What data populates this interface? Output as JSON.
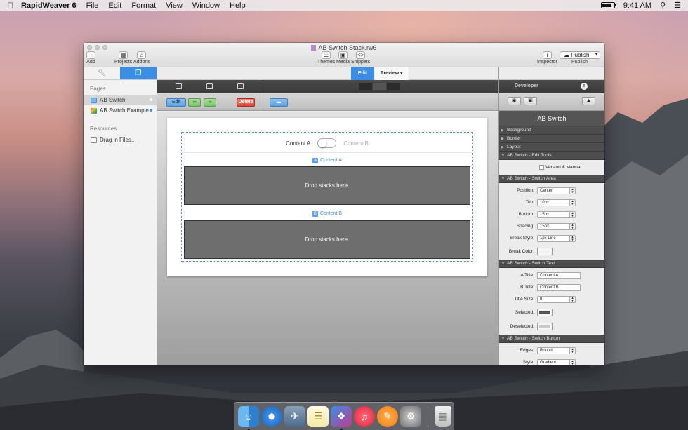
{
  "menubar": {
    "app_name": "RapidWeaver 6",
    "menus": [
      "File",
      "Edit",
      "Format",
      "View",
      "Window",
      "Help"
    ],
    "time": "9:41 AM",
    "battery_level": 0.85
  },
  "window": {
    "title": "AB Switch Stack.rw6",
    "toolbar": {
      "add": "Add",
      "projects": "Projects",
      "addons": "Addons",
      "themes": "Themes",
      "media": "Media",
      "snippets": "Snippets",
      "inspector": "Inspector",
      "publish_button": "Publish",
      "publish_label": "Publish"
    }
  },
  "sidebar": {
    "pages_heading": "Pages",
    "pages": [
      {
        "label": "AB Switch",
        "selected": true
      },
      {
        "label": "AB Switch Example",
        "selected": false
      }
    ],
    "resources_heading": "Resources",
    "resources_item": "Drag in Files..."
  },
  "main": {
    "edit_tab": "Edit",
    "preview_tab": "Preview",
    "stack_toolbar": {
      "edit": "Edit",
      "delete": "Delete"
    },
    "switch": {
      "title_a": "Content A",
      "title_b": "Content B"
    },
    "content_a_label": "Content A",
    "content_b_label": "Content B",
    "drop_a": "Drop stacks here.",
    "drop_b": "Drop stacks here."
  },
  "inspector": {
    "developer_label": "Developer",
    "title": "AB Switch",
    "sections": {
      "background": "Background",
      "border": "Border",
      "layout": "Layout",
      "edit_tools": "AB Switch - Edit Tools",
      "switch_area": "AB Switch - Switch Area",
      "switch_text": "AB Switch - Switch Text",
      "switch_button": "AB Switch - Switch Button"
    },
    "edit_tools": {
      "version_manual": "Version & Manual"
    },
    "switch_area": {
      "position_label": "Position:",
      "position_value": "Center",
      "top_label": "Top:",
      "top_value": "10px",
      "bottom_label": "Bottom:",
      "bottom_value": "15px",
      "spacing_label": "Spacing:",
      "spacing_value": "15px",
      "break_style_label": "Break Style:",
      "break_style_value": "1px Line",
      "break_color_label": "Break Color:",
      "break_color": "#f2f2f2"
    },
    "switch_text": {
      "a_title_label": "A Title:",
      "a_title_value": "Content A",
      "b_title_label": "B Title:",
      "b_title_value": "Content B",
      "title_size_label": "Title Size:",
      "title_size_value": "0",
      "selected_label": "Selected:",
      "selected_color": "#555555",
      "deselected_label": "Deselected:",
      "deselected_color": "#c8c8c8"
    },
    "switch_button": {
      "edges_label": "Edges:",
      "edges_value": "Round",
      "style_label": "Style:",
      "style_value": "Gradient"
    }
  },
  "colors": {
    "accent": "#3a8ee6",
    "delete": "#d64a3a",
    "link_green": "#7dc46c"
  }
}
